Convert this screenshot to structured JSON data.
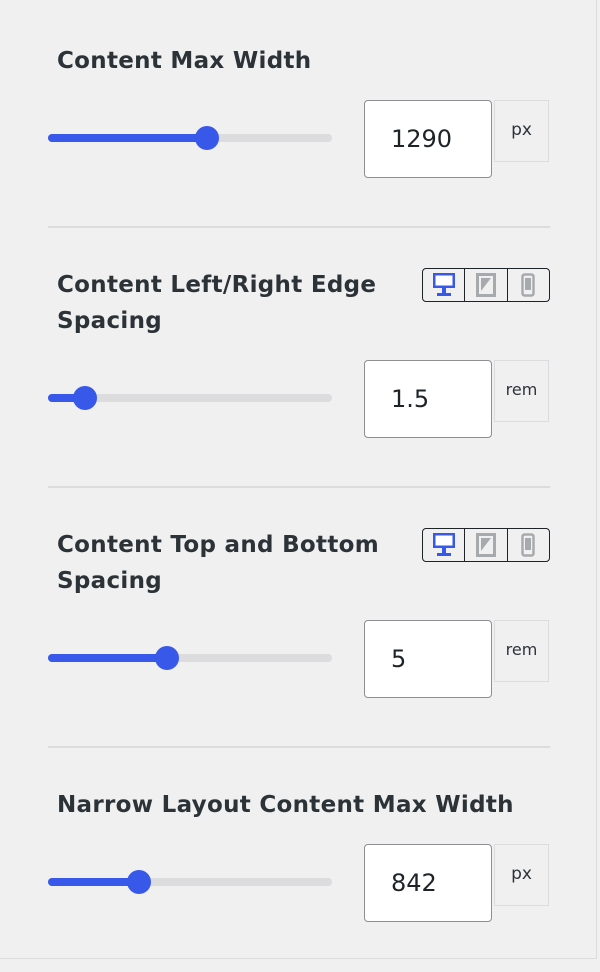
{
  "settings": [
    {
      "label": "Content Max Width",
      "value": "1290",
      "unit": "px",
      "slider_fraction": 0.56,
      "responsive": false
    },
    {
      "label": "Content Left/Right Edge Spacing",
      "value": "1.5",
      "unit": "rem",
      "slider_fraction": 0.13,
      "responsive": true,
      "active_device": "desktop"
    },
    {
      "label": "Content Top and Bottom Spacing",
      "value": "5",
      "unit": "rem",
      "slider_fraction": 0.42,
      "responsive": true,
      "active_device": "desktop"
    },
    {
      "label": "Narrow Layout Content Max Width",
      "value": "842",
      "unit": "px",
      "slider_fraction": 0.32,
      "responsive": false
    }
  ],
  "device_icons": [
    "desktop-icon",
    "tablet-icon",
    "mobile-icon"
  ],
  "colors": {
    "accent": "#3858e9",
    "track": "#dcdcde",
    "background": "#f0f0f1",
    "text": "#2c3338",
    "inactive_icon": "#a7aaad"
  }
}
